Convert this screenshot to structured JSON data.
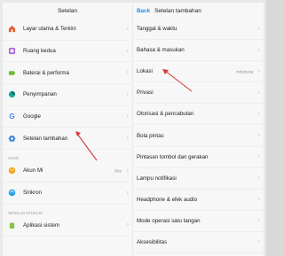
{
  "left": {
    "title": "Setelan",
    "items": [
      {
        "label": "Layar utama & Terkini",
        "icon": "home-icon",
        "color": "#e65a2f"
      },
      {
        "label": "Ruang kedua",
        "icon": "second-space-icon",
        "color": "#b26bd9"
      },
      {
        "label": "Baterai & performa",
        "icon": "battery-icon",
        "color": "#6cbf32"
      },
      {
        "label": "Penyimpanan",
        "icon": "storage-icon",
        "color": "#1aa39a"
      },
      {
        "label": "Google",
        "icon": "google-icon",
        "color": "#4285f4"
      },
      {
        "label": "Setelan tambahan",
        "icon": "gear-icon",
        "color": "#2f7fd8"
      }
    ],
    "section_akun": "AKUN",
    "akun_items": [
      {
        "label": "Akun Mi",
        "icon": "mi-account-icon",
        "color": "#f5a623",
        "value": "Dhe"
      },
      {
        "label": "Sinkron",
        "icon": "sync-icon",
        "color": "#24a0e8"
      }
    ],
    "section_app": "SETELAN APLIKASI",
    "app_items": [
      {
        "label": "Aplikasi sistem",
        "icon": "system-apps-icon",
        "color": "#8bc34a"
      }
    ]
  },
  "right": {
    "back": "Back",
    "title": "Setelan tambahan",
    "items": [
      {
        "label": "Tanggal & waktu"
      },
      {
        "label": "Bahasa & masukan"
      },
      {
        "label": "Lokasi",
        "value": "Indonesia"
      },
      {
        "label": "Privasi"
      },
      {
        "label": "Otorisasi & pencabutan"
      },
      {
        "label": "Bola pintas"
      },
      {
        "label": "Pintasan tombol dan gerakan"
      },
      {
        "label": "Lampu notifikasi"
      },
      {
        "label": "Headphone & efek audio"
      },
      {
        "label": "Mode operasi satu tangan"
      },
      {
        "label": "Aksesibilitas"
      }
    ]
  },
  "annotation_color": "#d93a3a"
}
